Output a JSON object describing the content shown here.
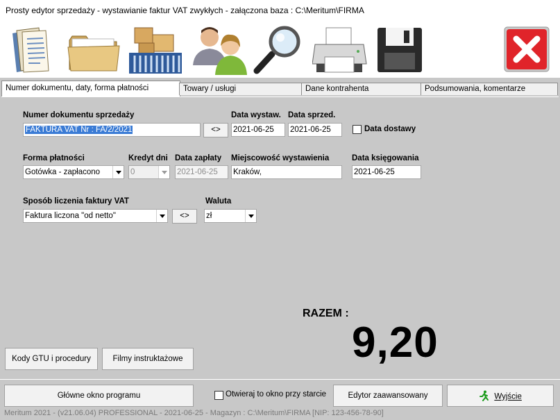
{
  "window": {
    "title": "Prosty edytor sprzedaży - wystawianie faktur VAT zwykłych   -  załączona baza : C:\\Meritum\\FIRMA"
  },
  "toolbar": {
    "icons": [
      "document-icon",
      "folder-icon",
      "warehouse-icon",
      "contractors-icon",
      "search-icon",
      "printer-icon",
      "save-icon",
      "close-icon"
    ],
    "close_color": "#e0242a"
  },
  "tabs": [
    {
      "label": "Numer dokumentu, daty, forma płatności",
      "active": true
    },
    {
      "label": "Towary  / usługi",
      "active": false
    },
    {
      "label": "Dane kontrahenta",
      "active": false
    },
    {
      "label": "Podsumowania, komentarze",
      "active": false
    }
  ],
  "form": {
    "doc_number": {
      "label": "Numer dokumentu sprzedaży",
      "value": "FAKTURA VAT Nr : FA/2/2021",
      "button": "<>"
    },
    "issue_date": {
      "label": "Data wystaw.",
      "value": "2021-06-25"
    },
    "sale_date": {
      "label": "Data sprzed.",
      "value": "2021-06-25"
    },
    "delivery_date": {
      "label": "Data dostawy",
      "checked": false
    },
    "payment_form": {
      "label": "Forma płatności",
      "value": "Gotówka - zapłacono"
    },
    "credit_days": {
      "label": "Kredyt dni",
      "value": "0"
    },
    "payment_date": {
      "label": "Data zapłaty",
      "value": "2021-06-25"
    },
    "place": {
      "label": "Miejscowość wystawienia",
      "value": "Kraków,"
    },
    "booking_date": {
      "label": "Data księgowania",
      "value": "2021-06-25"
    },
    "calc_method": {
      "label": "Sposób liczenia faktury VAT",
      "value": "Faktura liczona \"od netto\"",
      "button": "<>"
    },
    "currency": {
      "label": "Waluta",
      "value": "zł"
    }
  },
  "total": {
    "label": "RAZEM  :",
    "value": "9,20"
  },
  "buttons": {
    "gtu": "Kody GTU i procedury",
    "films": "Filmy instruktażowe",
    "main_window": "Główne okno programu",
    "open_at_start": "Otwieraj to okno przy starcie",
    "advanced_editor": "Edytor zaawansowany",
    "exit": "Wyjście"
  },
  "status": "Meritum 2021   -   (v21.06.04) PROFESSIONAL  -  2021-06-25  -  Magazyn :  C:\\Meritum\\FIRMA   [NIP: 123-456-78-90]"
}
